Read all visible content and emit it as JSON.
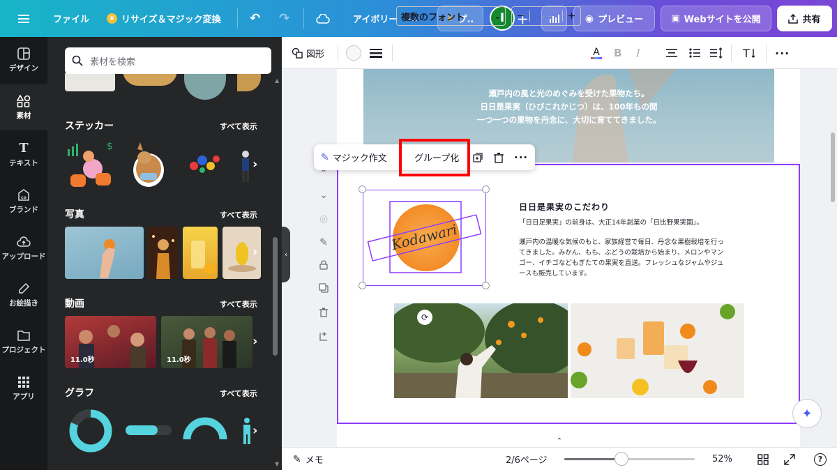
{
  "topbar": {
    "menu_icon": "menu-icon",
    "file": "ファイル",
    "resize": "リサイズ＆マジック変換",
    "title": "アイボリー",
    "title_more": "...",
    "pro": "プ..",
    "avatar_initial": "I",
    "preview": "プレビュー",
    "publish": "Webサイトを公開",
    "share": "共有"
  },
  "rail": {
    "items": [
      {
        "label": "デザイン",
        "icon": "design-icon"
      },
      {
        "label": "素材",
        "icon": "elements-icon"
      },
      {
        "label": "テキスト",
        "icon": "text-icon"
      },
      {
        "label": "ブランド",
        "icon": "brand-icon"
      },
      {
        "label": "アップロード",
        "icon": "upload-icon"
      },
      {
        "label": "お絵描き",
        "icon": "draw-icon"
      },
      {
        "label": "プロジェクト",
        "icon": "folder-icon"
      },
      {
        "label": "アプリ",
        "icon": "apps-icon"
      }
    ]
  },
  "panel": {
    "search_placeholder": "素材を検索",
    "sections": {
      "stickers": {
        "title": "ステッカー",
        "see_all": "すべて表示"
      },
      "photos": {
        "title": "写真",
        "see_all": "すべて表示"
      },
      "videos": {
        "title": "動画",
        "see_all": "すべて表示",
        "durations": [
          "11.0秒",
          "11.0秒"
        ]
      },
      "charts": {
        "title": "グラフ",
        "see_all": "すべて表示"
      }
    }
  },
  "editor_toolbar": {
    "shape": "図形",
    "font": "複数のフォント",
    "size": "– –",
    "minus": "−",
    "plus": "+"
  },
  "floating_toolbar": {
    "magic_write": "マジック作文",
    "group": "グループ化"
  },
  "design": {
    "hero_lines": [
      "瀬戸内の風と光のめぐみを受けた果物たち。",
      "日日是果実（ひびこれかじつ）は、100年もの間",
      "一つ一つの果物を丹念に、大切に育ててきました。"
    ],
    "kodawari_script": "Kodawari",
    "heading": "日日是果実のこだわり",
    "paragraph1": "「日日足果実」の前身は、大正14年創業の「日比野果実園」。",
    "paragraph2_lines": [
      "瀬戸内の温暖な気候のもと、家族経営で毎日、丹念な果樹栽培を行っ",
      "てきました。みかん、もも、ぶどうの栽培から始まり、メロンやマン",
      "ゴー、イチゴなどもぎたての果実を直送。フレッシュなジャムやジュ",
      "ースも販売しています。"
    ]
  },
  "bottombar": {
    "notes": "メモ",
    "page": "2/6ページ",
    "zoom": "52%",
    "zoom_fraction": 0.52
  }
}
